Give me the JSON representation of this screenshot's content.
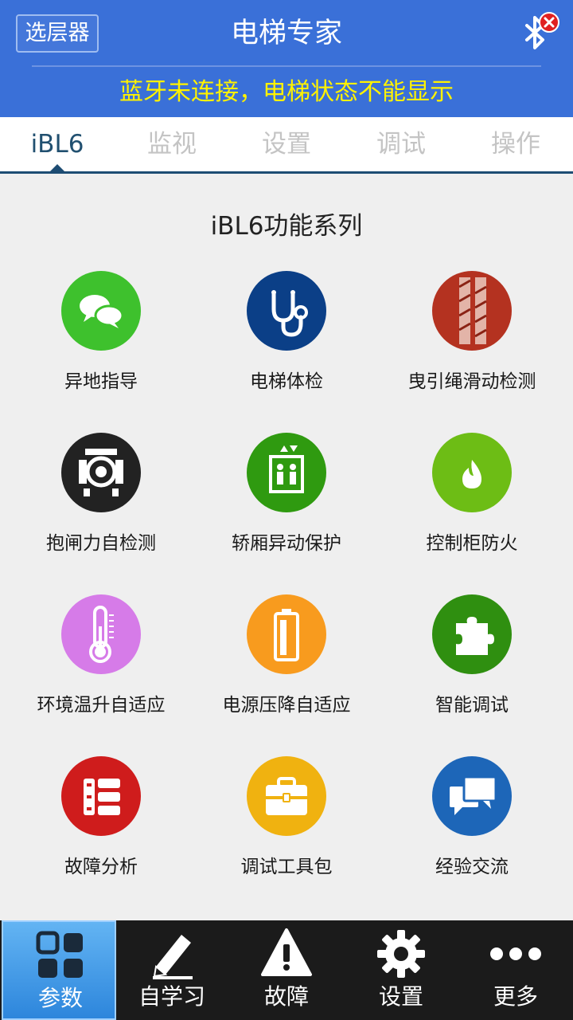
{
  "header": {
    "layer_button": "选层器",
    "title": "电梯专家",
    "status": "蓝牙未连接，电梯状态不能显示",
    "bluetooth_icon": "bluetooth-disconnected-icon"
  },
  "tabs": [
    {
      "label": "iBL6",
      "active": true
    },
    {
      "label": "监视",
      "active": false
    },
    {
      "label": "设置",
      "active": false
    },
    {
      "label": "调试",
      "active": false
    },
    {
      "label": "操作",
      "active": false
    }
  ],
  "section_title": "iBL6功能系列",
  "features": [
    {
      "label": "异地指导",
      "icon": "chat-bubbles-icon",
      "color": "#3ec12d"
    },
    {
      "label": "电梯体检",
      "icon": "stethoscope-icon",
      "color": "#0b3f87"
    },
    {
      "label": "曳引绳滑动检测",
      "icon": "rope-icon",
      "color": "#b43220"
    },
    {
      "label": "抱闸力自检测",
      "icon": "brake-icon",
      "color": "#222222"
    },
    {
      "label": "轿厢异动保护",
      "icon": "elevator-car-icon",
      "color": "#2f9a10"
    },
    {
      "label": "控制柜防火",
      "icon": "flame-icon",
      "color": "#6dbd15"
    },
    {
      "label": "环境温升自适应",
      "icon": "thermometer-icon",
      "color": "#d67be8"
    },
    {
      "label": "电源压降自适应",
      "icon": "battery-icon",
      "color": "#f89b1e"
    },
    {
      "label": "智能调试",
      "icon": "puzzle-icon",
      "color": "#2f8f10"
    },
    {
      "label": "故障分析",
      "icon": "list-icon",
      "color": "#cf1c1c"
    },
    {
      "label": "调试工具包",
      "icon": "toolbox-icon",
      "color": "#f0b210"
    },
    {
      "label": "经验交流",
      "icon": "message-icon",
      "color": "#1d66b8"
    }
  ],
  "bottom_nav": [
    {
      "label": "参数",
      "icon": "grid-icon",
      "active": true
    },
    {
      "label": "自学习",
      "icon": "pencil-icon",
      "active": false
    },
    {
      "label": "故障",
      "icon": "warning-icon",
      "active": false
    },
    {
      "label": "设置",
      "icon": "gear-icon",
      "active": false
    },
    {
      "label": "更多",
      "icon": "more-icon",
      "active": false
    }
  ]
}
